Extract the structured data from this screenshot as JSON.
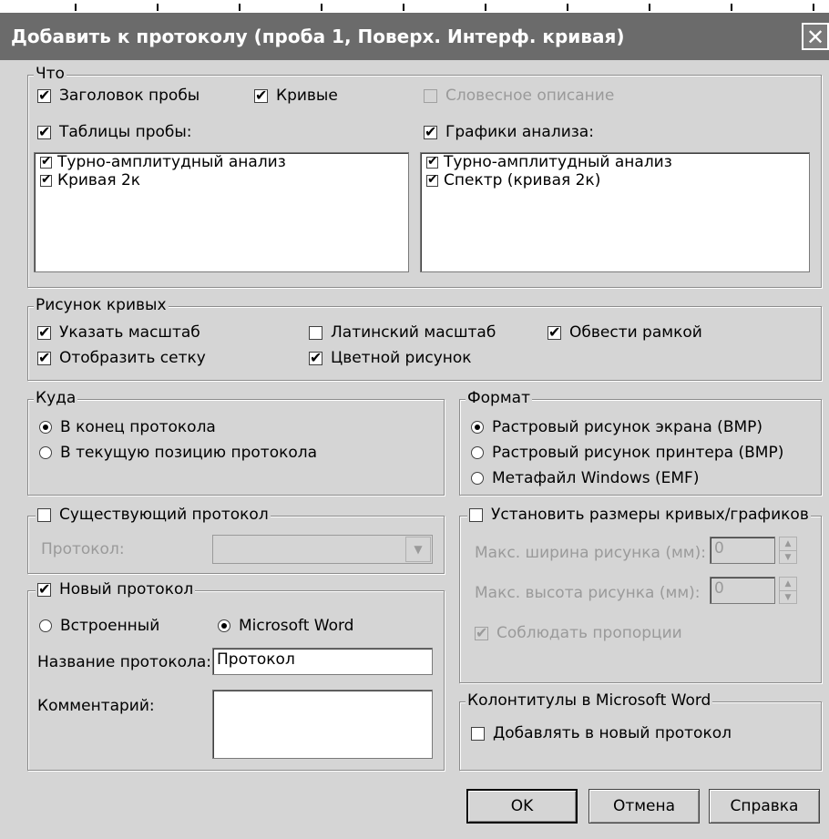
{
  "window": {
    "title": "Добавить к протоколу (проба 1, Поверх. Интерф. кривая)",
    "close_glyph": "✕"
  },
  "what": {
    "legend": "Что",
    "sample_header": {
      "label": "Заголовок пробы",
      "checked": true
    },
    "curves": {
      "label": "Кривые",
      "checked": true
    },
    "verbal": {
      "label": "Словесное описание",
      "checked": false,
      "disabled": true
    },
    "tables": {
      "label": "Таблицы пробы:",
      "checked": true,
      "items": [
        {
          "label": "Турно-амплитудный анализ",
          "checked": true
        },
        {
          "label": "Кривая 2к",
          "checked": true
        }
      ]
    },
    "graphs": {
      "label": "Графики анализа:",
      "checked": true,
      "items": [
        {
          "label": "Турно-амплитудный анализ",
          "checked": true
        },
        {
          "label": "Спектр (кривая 2к)",
          "checked": true
        }
      ]
    }
  },
  "drawing": {
    "legend": "Рисунок кривых",
    "scale": {
      "label": "Указать масштаб",
      "checked": true
    },
    "latin": {
      "label": "Латинский масштаб",
      "checked": false
    },
    "frame": {
      "label": "Обвести рамкой",
      "checked": true
    },
    "grid": {
      "label": "Отобразить сетку",
      "checked": true
    },
    "color": {
      "label": "Цветной рисунок",
      "checked": true
    }
  },
  "where": {
    "legend": "Куда",
    "options": [
      {
        "label": "В конец протокола",
        "selected": true
      },
      {
        "label": "В текущую позицию протокола",
        "selected": false
      }
    ]
  },
  "format": {
    "legend": "Формат",
    "options": [
      {
        "label": "Растровый рисунок экрана (BMP)",
        "selected": true
      },
      {
        "label": "Растровый рисунок принтера (BMP)",
        "selected": false
      },
      {
        "label": "Метафайл Windows (EMF)",
        "selected": false
      }
    ]
  },
  "existing": {
    "legend": "Существующий протокол",
    "checked": false,
    "protocol_label": "Протокол:",
    "protocol_value": ""
  },
  "sizes": {
    "legend": "Установить размеры кривых/графиков",
    "checked": false,
    "max_width_label": "Макс. ширина рисунка (мм):",
    "max_width": "0",
    "max_height_label": "Макс. высота рисунка (мм):",
    "max_height": "0",
    "proportions": {
      "label": "Соблюдать пропорции",
      "checked": true,
      "disabled": true
    }
  },
  "new_protocol": {
    "legend": "Новый протокол",
    "checked": true,
    "builtin": {
      "label": "Встроенный",
      "selected": false
    },
    "word": {
      "label": "Microsoft Word",
      "selected": true
    },
    "name_label": "Название протокола:",
    "name_value": "Протокол",
    "comment_label": "Комментарий:",
    "comment_value": ""
  },
  "headers": {
    "legend": "Колонтитулы в Microsoft Word",
    "add": {
      "label": "Добавлять в новый протокол",
      "checked": false
    }
  },
  "buttons": {
    "ok": "OK",
    "cancel": "Отмена",
    "help": "Справка"
  }
}
